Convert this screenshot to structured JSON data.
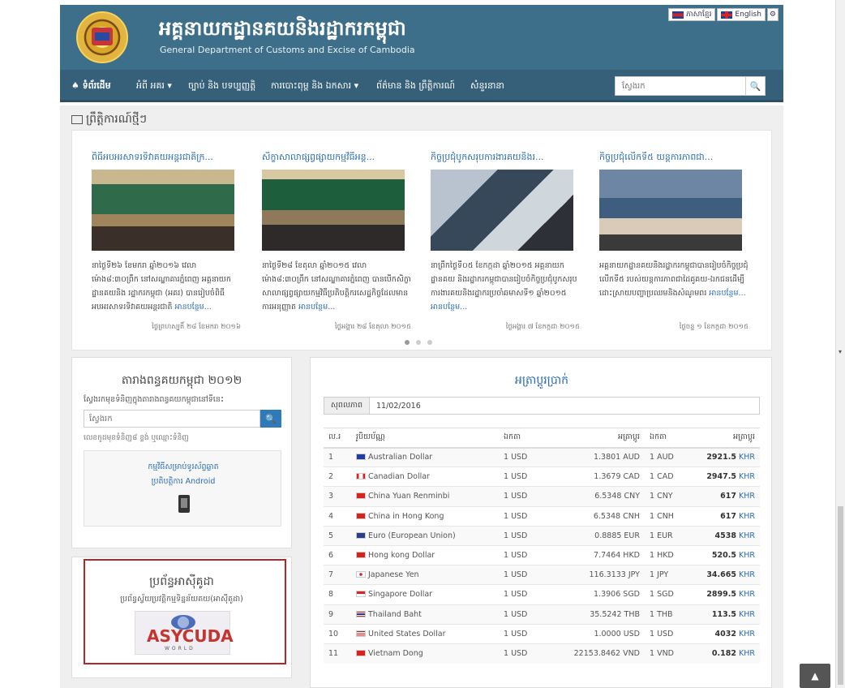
{
  "header": {
    "title_kh": "អគ្គនាយកដ្ឋានគយនិងរដ្ឋាករកម្ពុជា",
    "title_en": "General Department of Customs and Excise of Cambodia",
    "lang_kh": "ភាសាខ្មែរ",
    "lang_en": "English"
  },
  "nav": {
    "items": [
      {
        "label": "♠ ទំព័រដើម"
      },
      {
        "label": "អំពី អគរ ▾"
      },
      {
        "label": "ច្បាប់ និង បទប្បញ្ញត្តិ"
      },
      {
        "label": "ការបោះពុម្ព និង ឯកសារ ▾"
      },
      {
        "label": "ព័ត៌មាន និង ព្រឹត្តិការណ៍"
      },
      {
        "label": "សំនួរនានា"
      }
    ],
    "search_placeholder": "ស្វែងរក"
  },
  "news": {
    "heading": "ព្រឹត្តិការណ៍ថ្មីៗ",
    "items": [
      {
        "title": "ពិធីអបអរសាទរទិវាគយអន្តរជាតិក្រ...",
        "desc": "នាថ្ងៃទី២៦ ខែមករា ឆ្នាំ២០១៦ វេលាម៉ោង៨:៣០ព្រឹក នៅសណ្ឋាគារភ្នំពេញ អគ្គនាយកដ្ឋានគយនិង រដ្ឋាករកម្ពុជា (អគរ) បានរៀបចំពិធីអបអរសាទរទិវាគយអន្តរជាតិ",
        "more": "អានបន្ថែម...",
        "date": "ថ្ងៃព្រហស្បតិ៍ ២៨ ខែមករា ២០១៦"
      },
      {
        "title": "សិក្ខាសាលាផ្សព្វផ្សាយកម្មវិធីអន្ត...",
        "desc": "នាថ្ងៃទី២៨ ខែតុលា ឆ្នាំ២០១៥ វេលាម៉ោង៨:៣០ព្រឹក នៅសណ្ឋាគារភ្នំពេញ បានបើកសិក្ខាសាលាផ្សព្វផ្សាយកម្មវិធីប្រតិបត្តិករសេដ្ឋកិច្ចដែលមានការអនុញ្ញាត",
        "more": "អានបន្ថែម...",
        "date": "ថ្ងៃអង្គារ ២៨ ខែតុលា ២០១៥"
      },
      {
        "title": "កិច្ចប្រជុំបូកសរុបការងារគយនិងរ...",
        "desc": "នាព្រឹកថ្ងៃទី០៥ ខែកក្កដា ឆ្នាំ២០១៥ អគ្គនាយកដ្ឋានគយ និងរដ្ឋាករកម្ពុជាបានរៀបចំកិច្ចប្រជុំបូកសរុបការងារគយនិងរដ្ឋាករប្រចាំឆមាសទី១ ឆ្នាំ២០១៥",
        "more": "អានបន្ថែម...",
        "date": "ថ្ងៃអង្គារ ៧ ខែកក្កដា ២០១៥"
      },
      {
        "title": "កិច្ចប្រជុំលើកទី៥ យន្តការភាពជា...",
        "desc": "អគ្គនាយកដ្ឋានគយនិងរដ្ឋាករកម្ពុជាបានរៀបចំកិច្ចប្រជុំលើកទី៥ របស់យន្តការភាពជាដៃគូគយ-ឯកជនដើម្បីដោះស្រាយបញ្ហាប្រឈមនិងសំណូមពរ",
        "more": "អានបន្ថែម...",
        "date": "ថ្ងៃចន្ទ ១ ខែកក្កដា ២០១៥"
      }
    ]
  },
  "tariff": {
    "title": "តារាងពន្ធគយកម្ពុជា ២០១២",
    "subtitle": "ស្វែងរកមុខទំនិញក្នុងតារាងពន្ធគយកម្ពុជានៅទីនេះ",
    "search_placeholder": "ស្វែងរក",
    "hint": "លេខកូដមុខទំនិញ៨ ខ្ទង់ ឬឈ្មោះទំនិញ",
    "android_line1": "កម្មវិធីសម្រាប់ទូរស័ព្ទឆ្លាត",
    "android_line2": "ប្រតិបត្តិការ Android"
  },
  "asycuda": {
    "title": "ប្រព័ន្ធអាស៊ីគូដា",
    "subtitle": "ប្រព័ន្ធស្វ័យប្រវត្តិកម្មទិន្នន័យគយ(អាស៊ីគូដា)",
    "logo_word": "ASYCUDA",
    "logo_sub": "WORLD"
  },
  "exchange": {
    "title": "អត្រាប្តូរប្រាក់",
    "date_label": "សុពលភាព",
    "date_value": "11/02/2016",
    "headers": [
      "ល.រ",
      "រូបិយប័ណ្ណ",
      "ឯកតា",
      "អត្រាប្តូរ",
      "ឯកតា",
      "អត្រាប្តូរ"
    ],
    "rows": [
      {
        "no": "1",
        "flag": "au",
        "name": "Australian Dollar",
        "unit": "1 USD",
        "rate": "1.3801 AUD",
        "unit2": "1 AUD",
        "khr": "2921.5",
        "khr_unit": "KHR"
      },
      {
        "no": "2",
        "flag": "ca",
        "name": "Canadian Dollar",
        "unit": "1 USD",
        "rate": "1.3679 CAD",
        "unit2": "1 CAD",
        "khr": "2947.5",
        "khr_unit": "KHR"
      },
      {
        "no": "3",
        "flag": "cn",
        "name": "China Yuan Renminbi",
        "unit": "1 USD",
        "rate": "6.5348 CNY",
        "unit2": "1 CNY",
        "khr": "617",
        "khr_unit": "KHR"
      },
      {
        "no": "4",
        "flag": "cn",
        "name": "China in Hong Kong",
        "unit": "1 USD",
        "rate": "6.5348 CNH",
        "unit2": "1 CNH",
        "khr": "617",
        "khr_unit": "KHR"
      },
      {
        "no": "5",
        "flag": "eu",
        "name": "Euro (European Union)",
        "unit": "1 USD",
        "rate": "0.8885 EUR",
        "unit2": "1 EUR",
        "khr": "4538",
        "khr_unit": "KHR"
      },
      {
        "no": "6",
        "flag": "hk",
        "name": "Hong kong Dollar",
        "unit": "1 USD",
        "rate": "7.7464 HKD",
        "unit2": "1 HKD",
        "khr": "520.5",
        "khr_unit": "KHR"
      },
      {
        "no": "7",
        "flag": "jp",
        "name": "Japanese Yen",
        "unit": "1 USD",
        "rate": "116.3133 JPY",
        "unit2": "1 JPY",
        "khr": "34.665",
        "khr_unit": "KHR"
      },
      {
        "no": "8",
        "flag": "sg",
        "name": "Singapore Dollar",
        "unit": "1 USD",
        "rate": "1.3906 SGD",
        "unit2": "1 SGD",
        "khr": "2899.5",
        "khr_unit": "KHR"
      },
      {
        "no": "9",
        "flag": "th",
        "name": "Thailand Baht",
        "unit": "1 USD",
        "rate": "35.5242 THB",
        "unit2": "1 THB",
        "khr": "113.5",
        "khr_unit": "KHR"
      },
      {
        "no": "10",
        "flag": "us",
        "name": "United States Dollar",
        "unit": "1 USD",
        "rate": "1.0000 USD",
        "unit2": "1 USD",
        "khr": "4032",
        "khr_unit": "KHR"
      },
      {
        "no": "11",
        "flag": "vn",
        "name": "Vietnam Dong",
        "unit": "1 USD",
        "rate": "22153.8462 VND",
        "unit2": "1 VND",
        "khr": "0.182",
        "khr_unit": "KHR"
      }
    ]
  },
  "colors": {
    "header_bg": "#3e6f8a",
    "nav_bg": "#36607a",
    "link": "#2a6cb1",
    "highlight_border": "#b42727"
  }
}
